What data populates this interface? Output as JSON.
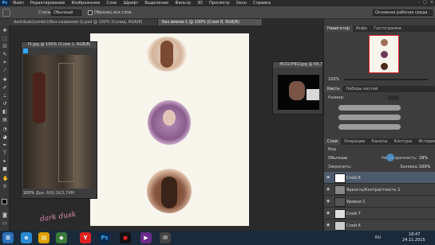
{
  "app": {
    "logo": "Ps",
    "menu": [
      "Файл",
      "Редактирование",
      "Изображение",
      "Слои",
      "Шрифт",
      "Выделение",
      "Фильтр",
      "3D",
      "Просмотр",
      "Окно",
      "Справка"
    ],
    "window_controls": [
      "–",
      "□",
      "×"
    ]
  },
  "options_bar": {
    "style_label": "Стиль:",
    "style_value": "Обычный",
    "sample_label": "Образец все слои",
    "workspace_value": "Основная рабочая среда"
  },
  "document_tabs": [
    "darkdusk(tumblr)(Без названия-1).psd @ 100% (Солид, RGB/8)",
    "Без имени-1 @ 100% (Слой 8, RGB/8)"
  ],
  "floating_windows": {
    "left_title": "IS.jpg @ 100% (Слой 1, RGB/8)",
    "left_zoom": "100%",
    "left_status": "Док: 600,1K/2,74M",
    "right_title": "4531(PNG)jpg @ 66,7..."
  },
  "navigator": {
    "tabs": [
      "Навигатор",
      "Инфо",
      "Гистограмма"
    ],
    "zoom": "100%"
  },
  "brushes": {
    "tabs": [
      "Кисть",
      "Наборы кистей"
    ],
    "size_label": "Размер:"
  },
  "layers": {
    "tabs": [
      "Слои",
      "Операции",
      "Каналы",
      "Контуры",
      "История"
    ],
    "kind_label": "Вид",
    "blend_mode": "Обычные",
    "opacity_label": "Непрозрачность:",
    "opacity_value": "29%",
    "lock_label": "Закрепить:",
    "fill_label": "Заливка:",
    "fill_value": "100%",
    "items": [
      {
        "name": "Слой 8",
        "selected": true
      },
      {
        "name": "Яркость/Контрастность 1",
        "selected": false
      },
      {
        "name": "Уровни 1",
        "selected": false
      },
      {
        "name": "Слой 7",
        "selected": false
      },
      {
        "name": "Слой 6",
        "selected": false
      }
    ]
  },
  "watermark": "dark dusk",
  "taskbar": {
    "time": "18:47",
    "date": "24.11.2015",
    "lang": "RU"
  },
  "colors": {
    "accent": "#4f9bd8",
    "canvas": "#f8f5ec",
    "photoshop_blue": "#31a8ff"
  }
}
